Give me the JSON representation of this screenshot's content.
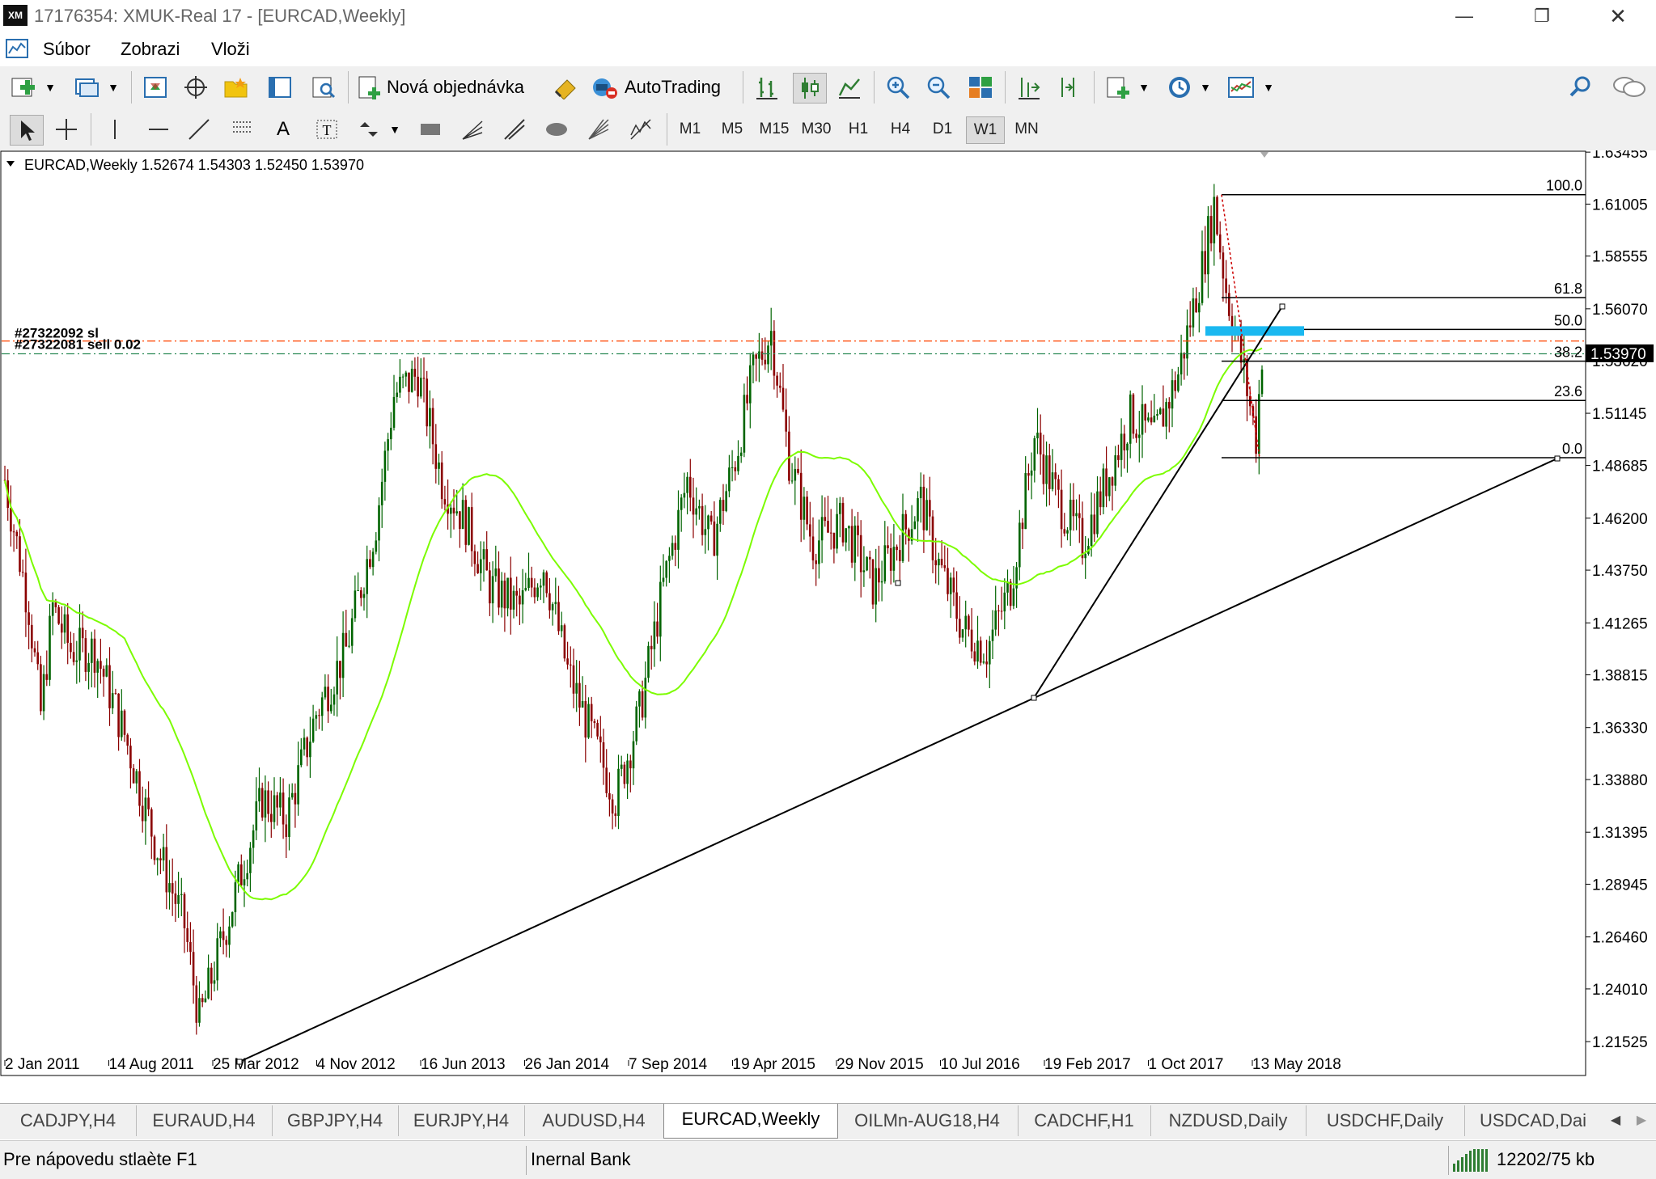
{
  "window": {
    "title": "17176354: XMUK-Real 17 - [EURCAD,Weekly]",
    "logo": "XM",
    "minimize_icon": "minimize-icon",
    "maximize_icon": "restore-icon",
    "close_icon": "close-icon"
  },
  "menu": {
    "items": [
      "Súbor",
      "Zobrazi",
      "Vloži"
    ]
  },
  "toolbar1": {
    "new_order_label": "Nová objednávka",
    "autotrading_label": "AutoTrading"
  },
  "toolbar2": {
    "timeframes": [
      "M1",
      "M5",
      "M15",
      "M30",
      "H1",
      "H4",
      "D1",
      "W1",
      "MN"
    ],
    "active_timeframe": "W1"
  },
  "chart_data": {
    "type": "candlestick",
    "symbol_header": "EURCAD,Weekly  1.52674 1.54303 1.52450 1.53970",
    "current_price": "1.53970",
    "y_ticks": [
      "1.63455",
      "1.61005",
      "1.58555",
      "1.56070",
      "1.53620",
      "1.51145",
      "1.48685",
      "1.46200",
      "1.43750",
      "1.41265",
      "1.38815",
      "1.36330",
      "1.33880",
      "1.31395",
      "1.28945",
      "1.26460",
      "1.24010",
      "1.21525"
    ],
    "ylim": [
      1.205,
      1.6346
    ],
    "x_ticks": [
      "2 Jan 2011",
      "14 Aug 2011",
      "25 Mar 2012",
      "4 Nov 2012",
      "16 Jun 2013",
      "26 Jan 2014",
      "7 Sep 2014",
      "19 Apr 2015",
      "29 Nov 2015",
      "10 Jul 2016",
      "19 Feb 2017",
      "1 Oct 2017",
      "13 May 2018"
    ],
    "order_labels": [
      "#27322092 sl",
      "#27322081 sell 0.02"
    ],
    "order_lines": [
      {
        "price": 1.5455,
        "color": "#ff4500",
        "style": "dash-dot"
      },
      {
        "price": 1.5395,
        "color": "#2e8b57",
        "style": "dash-dot"
      }
    ],
    "fibonacci": {
      "levels": [
        {
          "label": "100.0",
          "price": 1.6145
        },
        {
          "label": "61.8",
          "price": 1.566
        },
        {
          "label": "50.0",
          "price": 1.551
        },
        {
          "label": "38.2",
          "price": 1.536
        },
        {
          "label": "23.6",
          "price": 1.5175
        },
        {
          "label": "0.0",
          "price": 1.4905
        }
      ]
    },
    "moving_average_color": "#7cfc00",
    "highlight_zone": {
      "price_top": 1.5525,
      "price_bottom": 1.548,
      "color": "#1ab8f0"
    },
    "candle_bull_color": "#006400",
    "candle_bear_color": "#8b0000"
  },
  "tabs": {
    "items": [
      "CADJPY,H4",
      "EURAUD,H4",
      "GBPJPY,H4",
      "EURJPY,H4",
      "AUDUSD,H4",
      "EURCAD,Weekly",
      "OILMn-AUG18,H4",
      "CADCHF,H1",
      "NZDUSD,Daily",
      "USDCHF,Daily",
      "USDCAD,Dai"
    ],
    "active": "EURCAD,Weekly"
  },
  "status": {
    "help": "Pre nápovedu stlaète F1",
    "profile": "Inernal Bank",
    "traffic": "12202/75 kb"
  }
}
